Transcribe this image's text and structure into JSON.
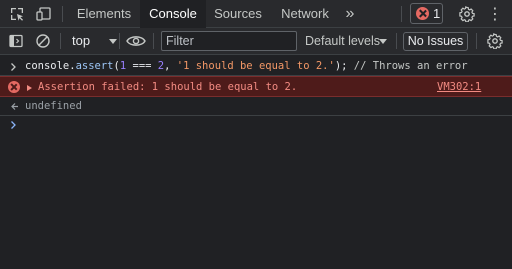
{
  "tabs": {
    "items": [
      "Elements",
      "Console",
      "Sources",
      "Network"
    ],
    "active": "Console",
    "more": "»"
  },
  "badge": {
    "error_count": "1"
  },
  "toolbar": {
    "context": "top",
    "filter_placeholder": "Filter",
    "levels": "Default levels",
    "issues": "No Issues"
  },
  "console": {
    "input": {
      "prefix": "console.",
      "method": "assert",
      "open": "(",
      "num1": "1",
      "op": " === ",
      "num2": "2",
      "comma": ", ",
      "str": "'1 should be equal to 2.'",
      "close": ");",
      "comment": " // Throws an error"
    },
    "error": {
      "message": "Assertion failed: 1 should be equal to 2.",
      "source": "VM302:1"
    },
    "result": "undefined"
  },
  "colors": {
    "background": "#202124",
    "toolbar": "#292a2d",
    "error_bg": "#4e1b1a",
    "error_text": "#f28b82",
    "accent": "#8ab4f8"
  }
}
